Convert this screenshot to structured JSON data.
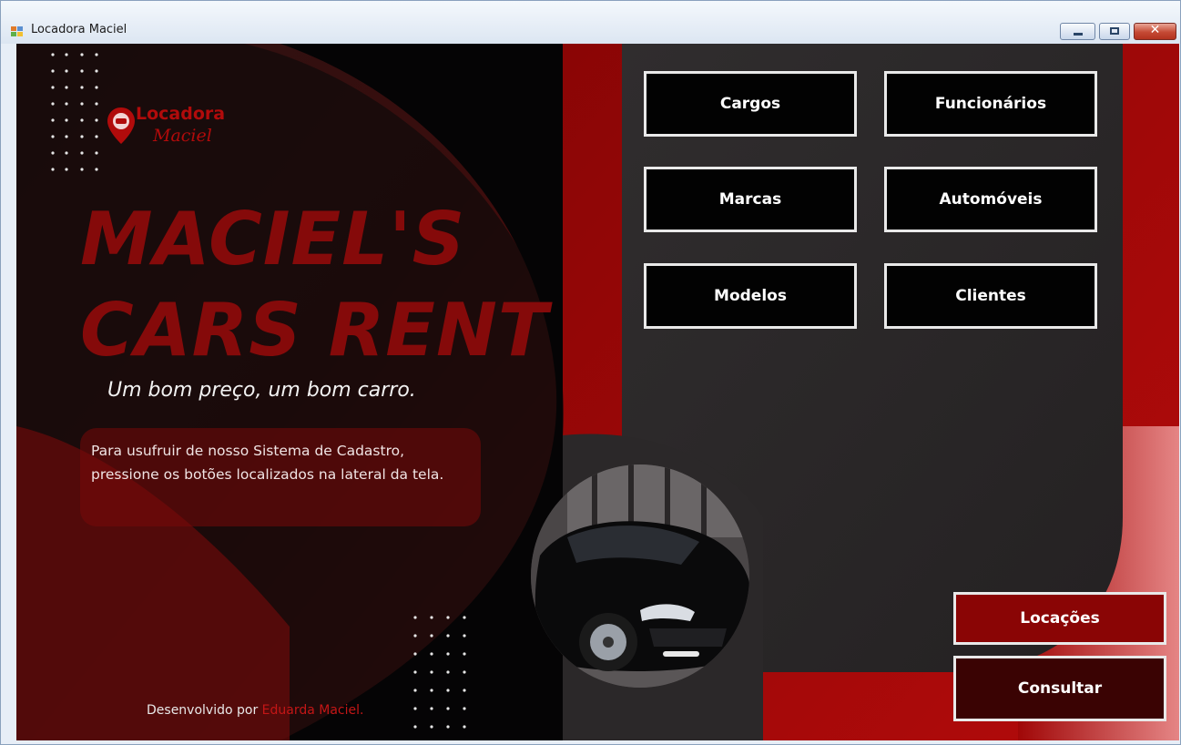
{
  "window": {
    "title": "Locadora Maciel",
    "controls": {
      "minimize": "",
      "maximize": "",
      "close": "✕"
    }
  },
  "brand": {
    "logo_line1": "Locadora",
    "logo_line2": "Maciel",
    "headline_line1": "MACIEL'S",
    "headline_line2": "CARS RENT",
    "tagline": "Um bom preço, um bom carro.",
    "info_text": "Para usufruir de nosso Sistema de Cadastro, pressione os botões localizados na lateral da tela.",
    "credit_prefix": "Desenvolvido por ",
    "credit_name": "Eduarda Maciel."
  },
  "menu": {
    "cargos": "Cargos",
    "funcionarios": "Funcionários",
    "marcas": "Marcas",
    "automoveis": "Automóveis",
    "modelos": "Modelos",
    "clientes": "Clientes"
  },
  "actions": {
    "locacoes": "Locações",
    "consultar": "Consultar"
  },
  "icons": {
    "app": "form-icon",
    "logo": "location-pin-icon"
  },
  "colors": {
    "accent_red": "#b10b0b",
    "dark_bg": "#0b0809",
    "panel_gray": "#2b2829",
    "button_bg": "#020202",
    "button_border": "#e9e9e9"
  }
}
